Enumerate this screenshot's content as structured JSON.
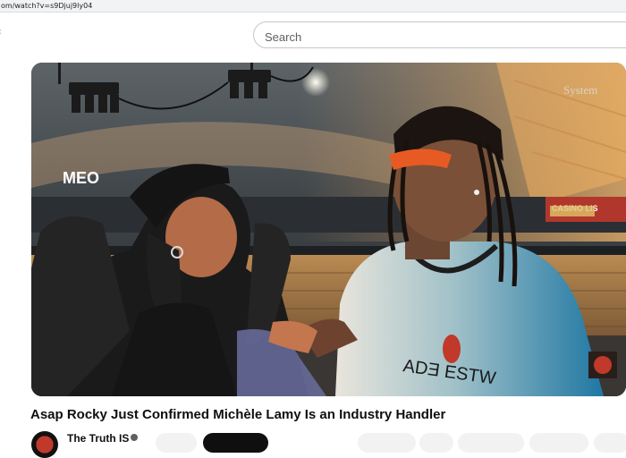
{
  "browser": {
    "url": "om/watch?v=s9Djuj9ly04"
  },
  "search": {
    "placeholder": "Search"
  },
  "video": {
    "title": "Asap Rocky Just Confirmed Michèle Lamy Is an Industry Handler",
    "overlays": {
      "arena_logo": "MEO",
      "watermark": "System",
      "side_banner": "CASINO LIS"
    },
    "channel_name": "The Truth IS"
  },
  "icons": [
    "back-glyph",
    "verified-icon",
    "channel-avatar",
    "corner-logo-icon"
  ],
  "colors": {
    "page_bg": "#ffffff",
    "search_border": "#c6c6c6",
    "title": "#0f0f0f",
    "subscribe_bg": "#0f0f0f"
  }
}
